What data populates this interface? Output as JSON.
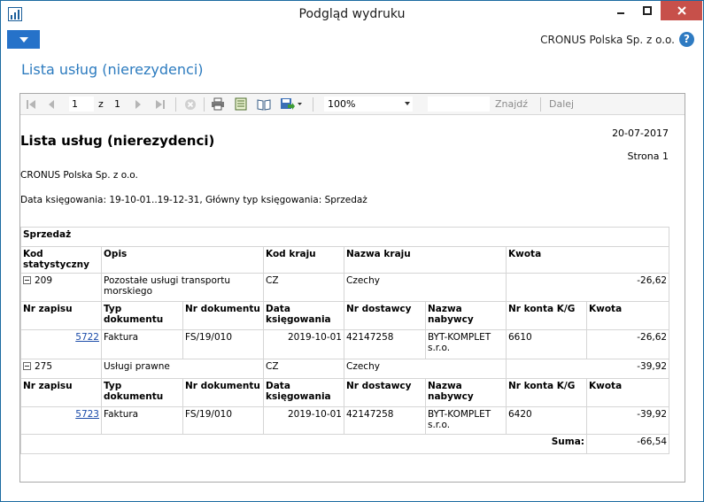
{
  "window": {
    "title": "Podgląd wydruku"
  },
  "ribbon": {
    "company": "CRONUS Polska Sp. z o.o."
  },
  "page": {
    "title": "Lista usług (nierezydenci)"
  },
  "toolbar": {
    "page_current": "1",
    "page_of": "z",
    "page_total": "1",
    "zoom": "100%",
    "find": "Znajdź",
    "next": "Dalej",
    "icons": [
      "first-page-icon",
      "previous-page-icon",
      "next-page-icon",
      "last-page-icon",
      "stop-icon",
      "print-icon",
      "print-layout-icon",
      "page-setup-icon",
      "export-icon"
    ]
  },
  "report": {
    "title": "Lista usług (nierezydenci)",
    "date": "20-07-2017",
    "page": "Strona 1",
    "company": "CRONUS Polska Sp. z o.o.",
    "filter": "Data księgowania: 19-10-01..19-12-31, Główny typ księgowania: Sprzedaż",
    "section": "Sprzedaż",
    "headers": {
      "code": "Kod statystyczny",
      "description": "Opis",
      "country_code": "Kod kraju",
      "country_name": "Nazwa kraju",
      "amount": "Kwota"
    },
    "detail_headers": {
      "entry_no": "Nr zapisu",
      "doc_type": "Typ dokumentu",
      "doc_no": "Nr dokumentu",
      "posting_date": "Data księgowania",
      "vendor_no": "Nr dostawcy",
      "buyer_name": "Nazwa nabywcy",
      "gl_account": "Nr konta K/G",
      "amount": "Kwota"
    },
    "groups": [
      {
        "code": "209",
        "description": "Pozostałe usługi transportu morskiego",
        "country_code": "CZ",
        "country_name": "Czechy",
        "amount": "-26,62",
        "entry": {
          "entry_no": "5722",
          "doc_type": "Faktura",
          "doc_no": "FS/19/010",
          "posting_date": "2019-10-01",
          "vendor_no": "42147258",
          "buyer_name": "BYT-KOMPLET s.r.o.",
          "gl_account": "6610",
          "amount": "-26,62"
        }
      },
      {
        "code": "275",
        "description": "Usługi prawne",
        "country_code": "CZ",
        "country_name": "Czechy",
        "amount": "-39,92",
        "entry": {
          "entry_no": "5723",
          "doc_type": "Faktura",
          "doc_no": "FS/19/010",
          "posting_date": "2019-10-01",
          "vendor_no": "42147258",
          "buyer_name": "BYT-KOMPLET s.r.o.",
          "gl_account": "6420",
          "amount": "-39,92"
        }
      }
    ],
    "total_label": "Suma:",
    "total_amount": "-66,54"
  }
}
